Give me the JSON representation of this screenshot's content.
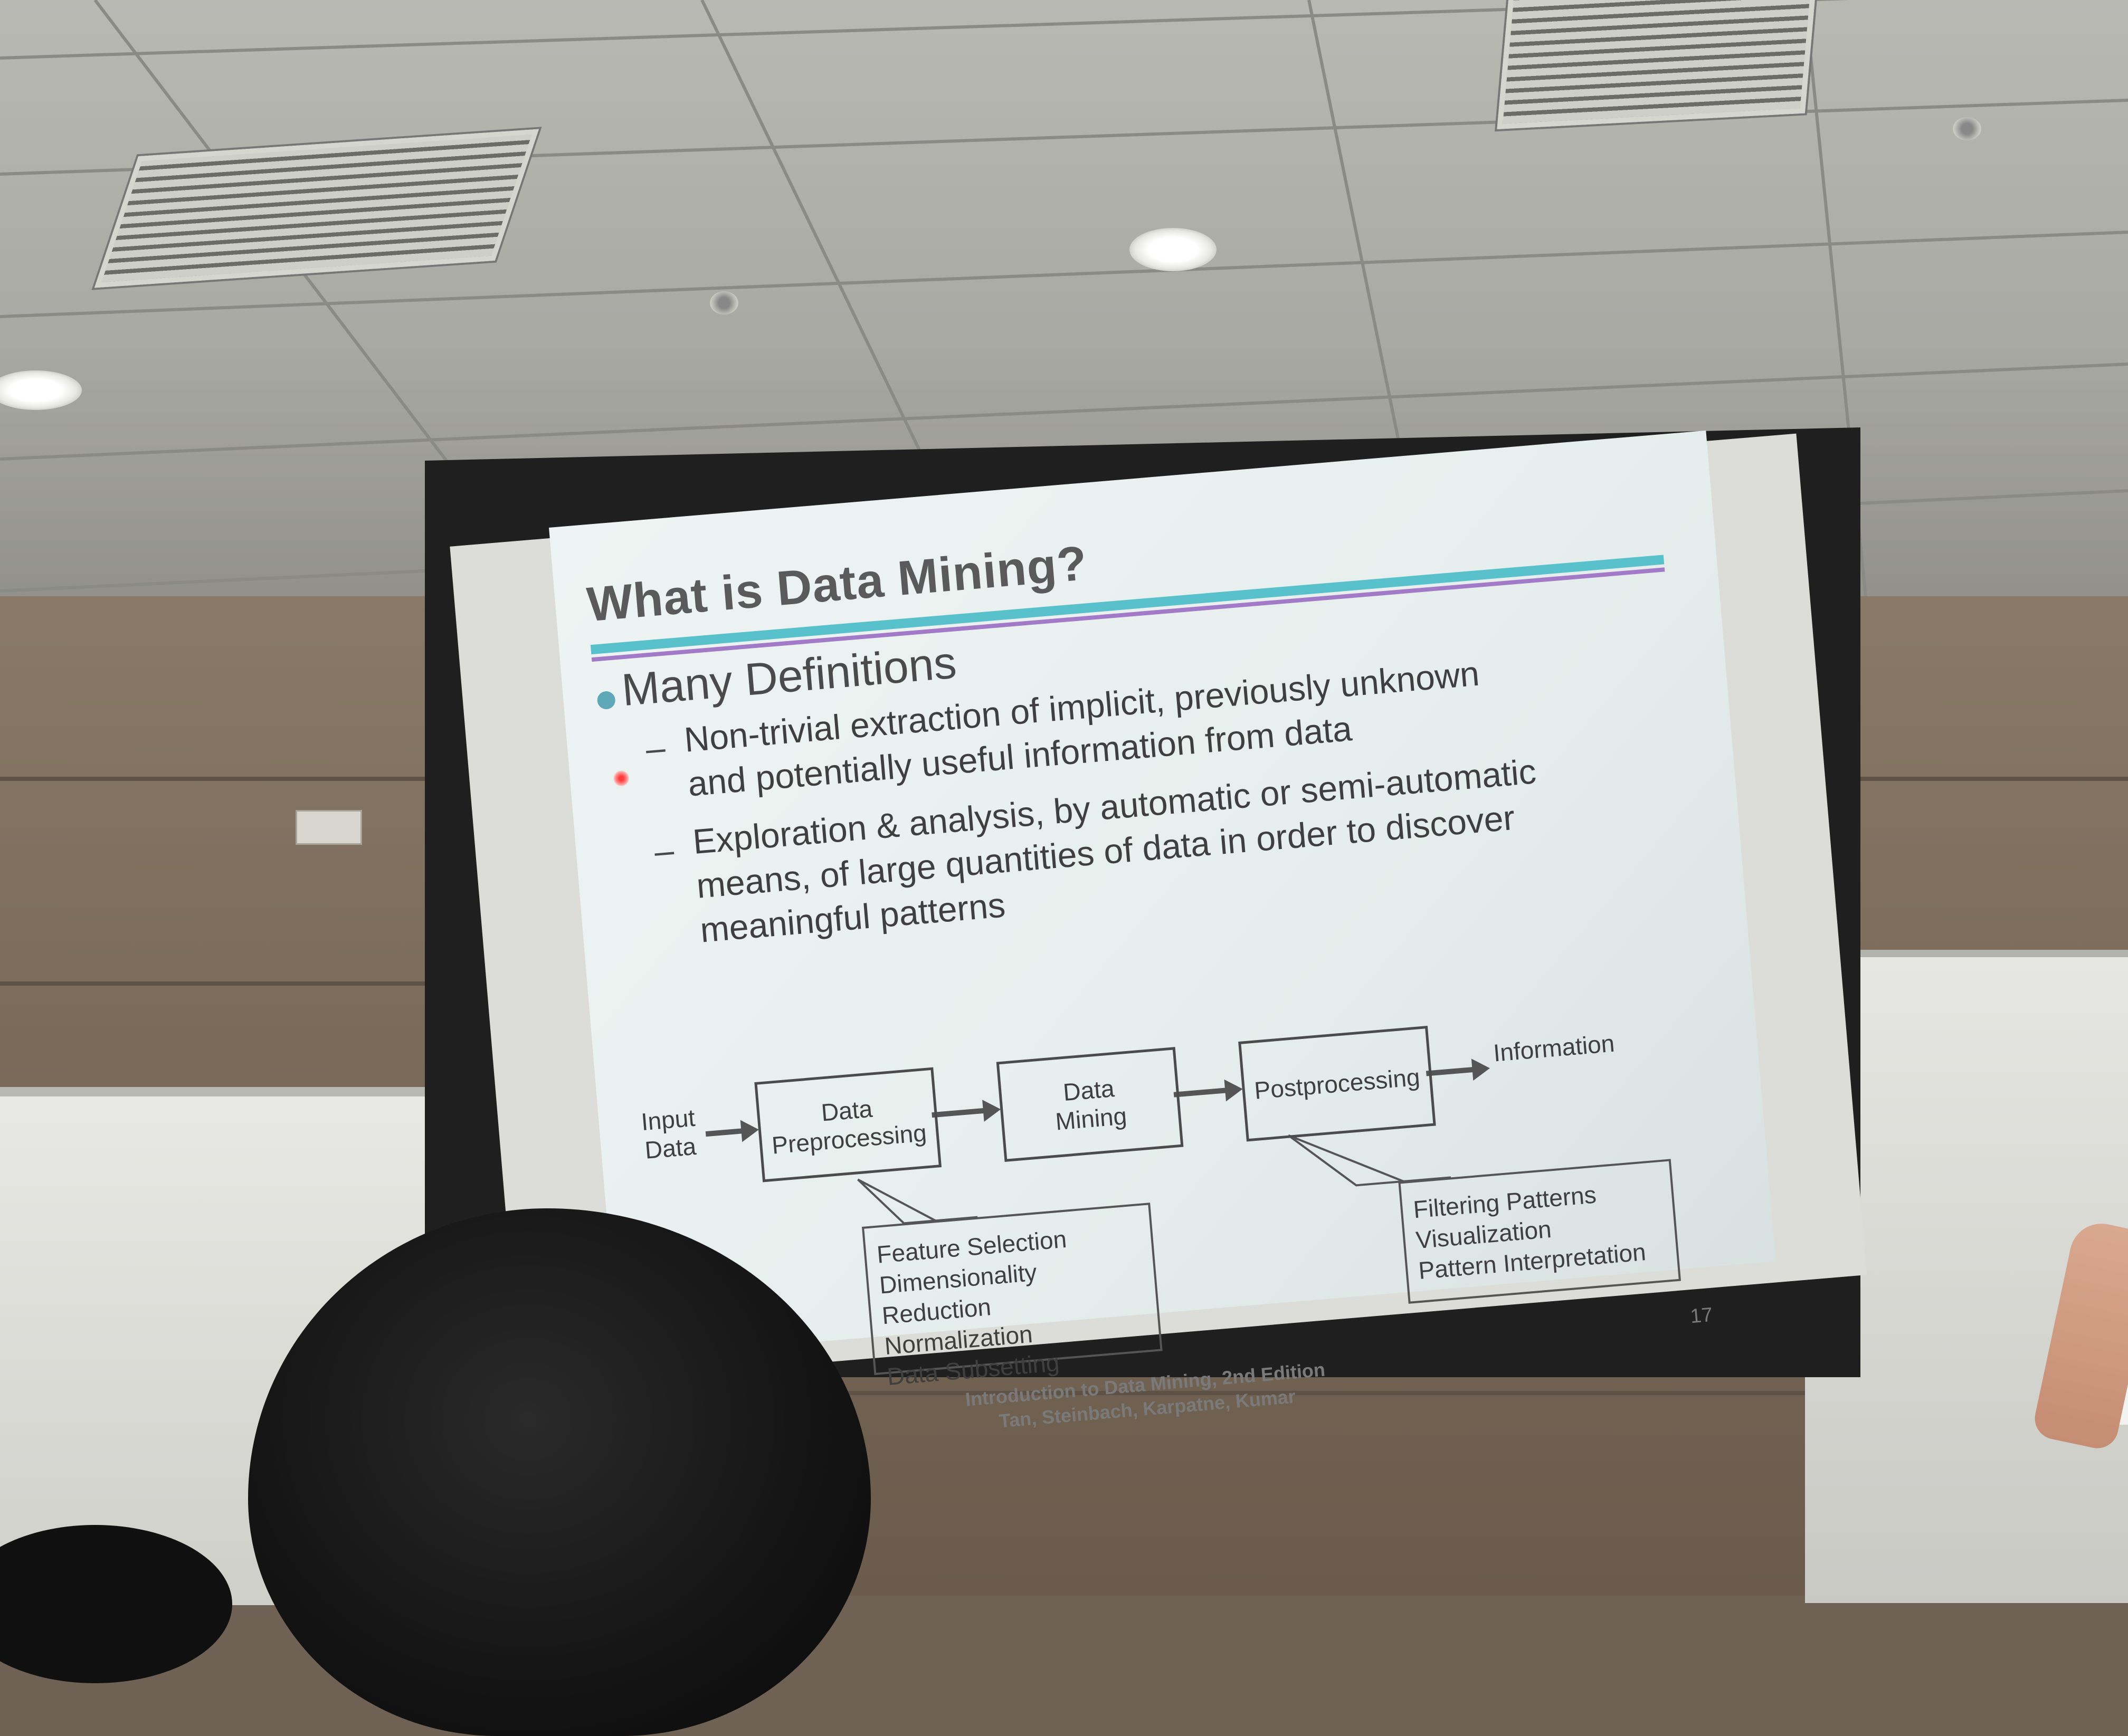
{
  "slide": {
    "title": "What is Data Mining?",
    "bullet": "Many Definitions",
    "dash": "–",
    "definitions": [
      "Non-trivial extraction of implicit, previously unknown\nand potentially useful information from data",
      "Exploration & analysis, by automatic or semi-automatic\nmeans, of large quantities of data in order to discover\nmeaningful patterns"
    ],
    "diagram": {
      "input": "Input\nData",
      "preprocessing": "Data\nPreprocessing",
      "mining": "Data\nMining",
      "postprocessing": "Postprocessing",
      "output": "Information",
      "pre_tasks": [
        "Feature Selection",
        "Dimensionality Reduction",
        "Normalization",
        "Data Subsetting"
      ],
      "post_tasks": [
        "Filtering Patterns",
        "Visualization",
        "Pattern Interpretation"
      ]
    },
    "footer_line1": "Introduction to Data Mining, 2nd Edition",
    "footer_line2": "Tan, Steinbach, Karpatne, Kumar",
    "page_number": "17"
  },
  "colors": {
    "rule_teal": "#59c1cc",
    "rule_purple": "#a37ac8",
    "bullet": "#5ea8b8",
    "laser_pointer": "#ff3b3b"
  }
}
